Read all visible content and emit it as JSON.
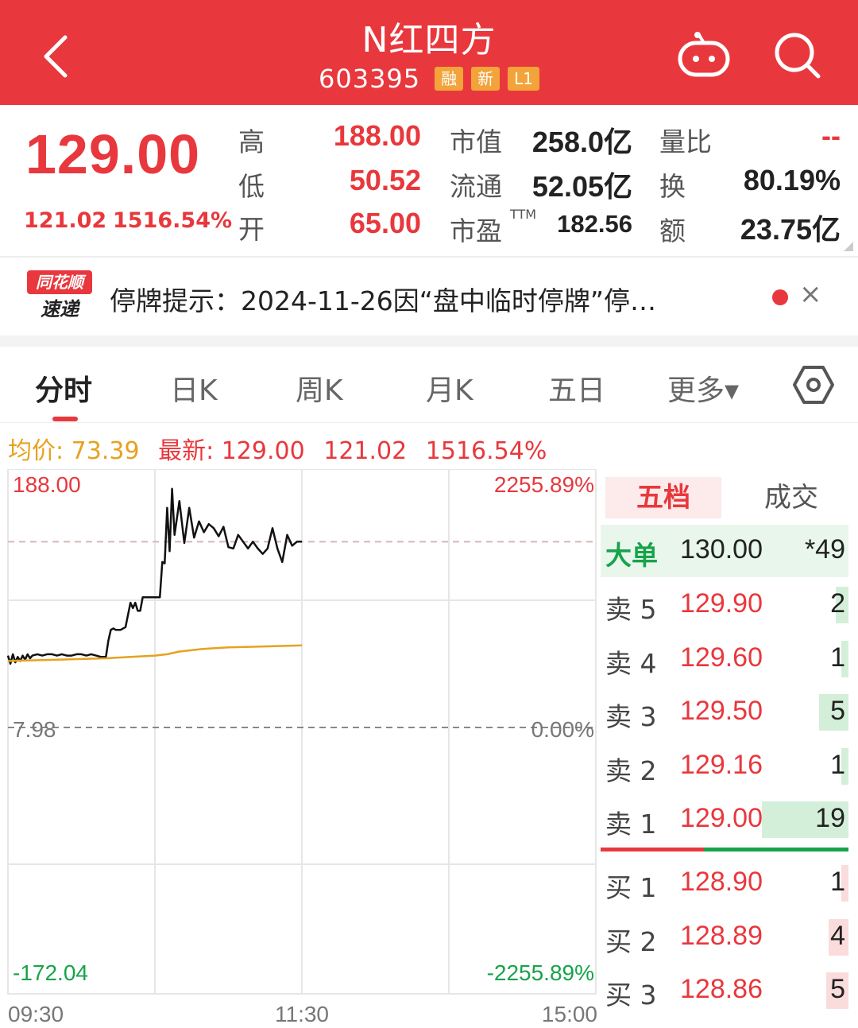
{
  "header": {
    "title": "N红四方",
    "code": "603395",
    "tags": [
      "融",
      "新",
      "L1"
    ]
  },
  "quote": {
    "price": "129.00",
    "change": "121.02",
    "change_pct": "1516.54%",
    "high_label": "高",
    "high": "188.00",
    "low_label": "低",
    "low": "50.52",
    "open_label": "开",
    "open": "65.00",
    "mcap_label": "市值",
    "mcap": "258.0亿",
    "float_label": "流通",
    "float": "52.05亿",
    "pe_label": "市盈",
    "pe_sup": "TTM",
    "pe": "182.56",
    "vr_label": "量比",
    "vr": "--",
    "turnover_label": "换",
    "turnover": "80.19%",
    "amount_label": "额",
    "amount": "23.75亿"
  },
  "notice": {
    "logo_top": "同花顺",
    "logo_bottom": "速递",
    "text": "停牌提示：2024-11-26因“盘中临时停牌”停…",
    "close": "×"
  },
  "tabs": [
    "分时",
    "日K",
    "周K",
    "月K",
    "五日",
    "更多▾"
  ],
  "info_line": {
    "avg": "均价: 73.39",
    "last": "最新: 129.00",
    "chg": "121.02",
    "pct": "1516.54%"
  },
  "chart": {
    "y_top": "188.00",
    "y_base": "7.98",
    "y_bottom": "-172.04",
    "pct_top": "2255.89%",
    "pct_base": "0.00%",
    "pct_bottom": "-2255.89%",
    "x_start": "09:30",
    "x_mid": "11:30",
    "x_end": "15:00",
    "colors": {
      "price": "#111111",
      "avg": "#e6a21f",
      "up": "#e8383d",
      "down": "#17a34a"
    }
  },
  "chart_data": {
    "type": "line",
    "x_range_minutes": [
      0,
      240
    ],
    "ylim": [
      -172.04,
      188.0
    ],
    "base": 7.98,
    "series": [
      {
        "x": [
          0,
          1,
          2,
          3,
          4,
          5,
          6,
          7,
          8,
          9,
          10,
          12,
          14,
          16,
          18,
          20,
          22,
          24,
          26,
          28,
          30,
          32,
          34,
          36,
          38,
          40,
          41,
          42,
          43,
          44,
          46,
          48,
          50,
          51,
          52,
          53,
          54,
          55,
          56,
          57,
          58,
          59,
          60,
          61,
          62,
          63,
          64,
          65,
          66,
          67,
          68,
          70,
          72,
          74,
          76,
          78,
          80,
          82,
          84,
          86,
          88,
          90,
          92,
          94,
          96,
          98,
          100,
          102,
          104,
          106,
          108,
          110,
          112,
          114,
          116,
          118,
          120
        ],
        "values": [
          61,
          55,
          62,
          56,
          60,
          57,
          61,
          58,
          62,
          59,
          61,
          62,
          61,
          62,
          62,
          61,
          62,
          61,
          61,
          62,
          62,
          61,
          62,
          61,
          60,
          60,
          72,
          80,
          81,
          80,
          80,
          82,
          100,
          96,
          100,
          94,
          94,
          104,
          104,
          104,
          104,
          104,
          104,
          104,
          104,
          130,
          129,
          170,
          138,
          184,
          150,
          175,
          144,
          170,
          148,
          160,
          152,
          158,
          155,
          149,
          156,
          141,
          140,
          150,
          145,
          140,
          145,
          140,
          136,
          140,
          155,
          140,
          130,
          150,
          142,
          145,
          145
        ]
      },
      {
        "x": [
          0,
          20,
          40,
          50,
          60,
          65,
          70,
          80,
          90,
          100,
          110,
          120
        ],
        "values": [
          57,
          58,
          59,
          60,
          61,
          62,
          64,
          66,
          67,
          67.5,
          68,
          68.5
        ]
      }
    ]
  },
  "book": {
    "tab_active": "五档",
    "tab_other": "成交",
    "big": {
      "label": "大单",
      "price": "130.00",
      "vol": "*49"
    },
    "sells": [
      {
        "label": "卖 5",
        "price": "129.90",
        "vol": "2",
        "bar": 0.05
      },
      {
        "label": "卖 4",
        "price": "129.60",
        "vol": "1",
        "bar": 0.03
      },
      {
        "label": "卖 3",
        "price": "129.50",
        "vol": "5",
        "bar": 0.12
      },
      {
        "label": "卖 2",
        "price": "129.16",
        "vol": "1",
        "bar": 0.03
      },
      {
        "label": "卖 1",
        "price": "129.00",
        "vol": "19",
        "bar": 0.35
      }
    ],
    "buys": [
      {
        "label": "买 1",
        "price": "128.90",
        "vol": "1",
        "bar": 0.03
      },
      {
        "label": "买 2",
        "price": "128.89",
        "vol": "4",
        "bar": 0.08
      },
      {
        "label": "买 3",
        "price": "128.86",
        "vol": "5",
        "bar": 0.09
      }
    ]
  }
}
